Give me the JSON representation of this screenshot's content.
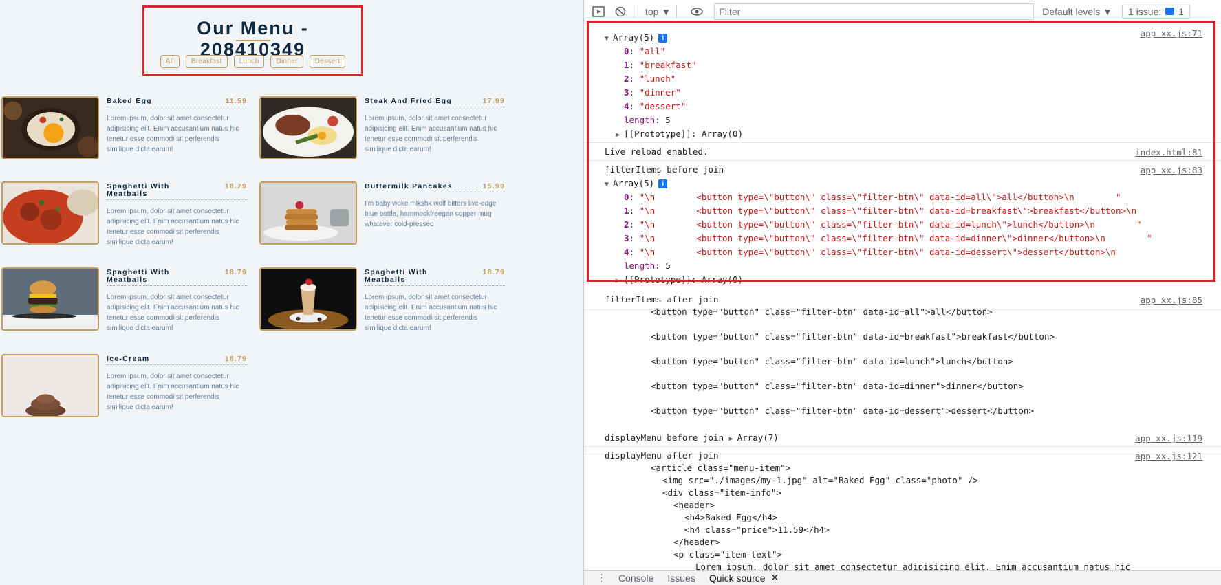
{
  "menu_page": {
    "title": "Our Menu - 208410349",
    "filters": [
      "All",
      "Breakfast",
      "Lunch",
      "Dinner",
      "Dessert"
    ],
    "items": [
      {
        "name": "Baked Egg",
        "price": "11.59",
        "text": "Lorem ipsum, dolor sit amet consectetur adipisicing elit. Enim accusantium natus hic tenetur esse commodi sit perferendis similique dicta earum!"
      },
      {
        "name": "Steak And Fried Egg",
        "price": "17.99",
        "text": "Lorem ipsum, dolor sit amet consectetur adipisicing elit. Enim accusantium natus hic tenetur esse commodi sit perferendis similique dicta earum!"
      },
      {
        "name": "Spaghetti With Meatballs",
        "price": "18.79",
        "text": "Lorem ipsum, dolor sit amet consectetur adipisicing elit. Enim accusantium natus hic tenetur esse commodi sit perferendis similique dicta earum!"
      },
      {
        "name": "Buttermilk Pancakes",
        "price": "15.99",
        "text": "I'm baby woke mlkshk wolf bitters live-edge blue bottle, hammockfreegan copper mug whatever cold-pressed"
      },
      {
        "name": "Spaghetti With Meatballs",
        "price": "18.79",
        "text": "Lorem ipsum, dolor sit amet consectetur adipisicing elit. Enim accusantium natus hic tenetur esse commodi sit perferendis similique dicta earum!"
      },
      {
        "name": "Spaghetti With Meatballs",
        "price": "18.79",
        "text": "Lorem ipsum, dolor sit amet consectetur adipisicing elit. Enim accusantium natus hic tenetur esse commodi sit perferendis similique dicta earum!"
      },
      {
        "name": "Ice-Cream",
        "price": "18.79",
        "text": "Lorem ipsum, dolor sit amet consectetur adipisicing elit. Enim accusantium natus hic tenetur esse commodi sit perferendis similique dicta earum!"
      }
    ]
  },
  "devtools": {
    "toolbar": {
      "context": "top ▼",
      "filter_placeholder": "Filter",
      "levels": "Default levels ▼",
      "issues": "1 issue:",
      "issues_count": "1"
    },
    "messages": {
      "m1": {
        "source": "app_xx.js:71",
        "array_label": "Array(5)",
        "entries": [
          {
            "k": "0",
            "v": "\"all\""
          },
          {
            "k": "1",
            "v": "\"breakfast\""
          },
          {
            "k": "2",
            "v": "\"lunch\""
          },
          {
            "k": "3",
            "v": "\"dinner\""
          },
          {
            "k": "4",
            "v": "\"dessert\""
          }
        ],
        "length_key": "length",
        "length_val": "5",
        "proto": "[[Prototype]]: Array(0)"
      },
      "m2": {
        "text": "Live reload enabled.",
        "source": "index.html:81"
      },
      "m3": {
        "text": "filterItems before join",
        "source": "app_xx.js:83",
        "array_label": "Array(5)",
        "entries": [
          {
            "k": "0",
            "v": "\"\\n        <button type=\\\"button\\\" class=\\\"filter-btn\\\" data-id=all\\\">all</button>\\n        \""
          },
          {
            "k": "1",
            "v": "\"\\n        <button type=\\\"button\\\" class=\\\"filter-btn\\\" data-id=breakfast\\\">breakfast</button>\\n"
          },
          {
            "k": "2",
            "v": "\"\\n        <button type=\\\"button\\\" class=\\\"filter-btn\\\" data-id=lunch\\\">lunch</button>\\n        \""
          },
          {
            "k": "3",
            "v": "\"\\n        <button type=\\\"button\\\" class=\\\"filter-btn\\\" data-id=dinner\\\">dinner</button>\\n        \""
          },
          {
            "k": "4",
            "v": "\"\\n        <button type=\\\"button\\\" class=\\\"filter-btn\\\" data-id=dessert\\\">dessert</button>\\n"
          }
        ],
        "length_key": "length",
        "length_val": "5",
        "proto": "[[Prototype]]: Array(0)"
      },
      "m4": {
        "text": "filterItems after join",
        "source": "app_xx.js:85",
        "lines": [
          "<button type=\"button\" class=\"filter-btn\" data-id=all\">all</button>",
          "<button type=\"button\" class=\"filter-btn\" data-id=breakfast\">breakfast</button>",
          "<button type=\"button\" class=\"filter-btn\" data-id=lunch\">lunch</button>",
          "<button type=\"button\" class=\"filter-btn\" data-id=dinner\">dinner</button>",
          "<button type=\"button\" class=\"filter-btn\" data-id=dessert\">dessert</button>"
        ]
      },
      "m5": {
        "text": "displayMenu before join",
        "array_label": "Array(7)",
        "source": "app_xx.js:119"
      },
      "m6": {
        "text": "displayMenu after join",
        "source": "app_xx.js:121",
        "lines": [
          "<article class=\"menu-item\">",
          "<img src=\"./images/my-1.jpg\" alt=\"Baked Egg\" class=\"photo\" />",
          "<div class=\"item-info\">",
          "<header>",
          "<h4>Baked Egg</h4>",
          "<h4 class=\"price\">11.59</h4>",
          "</header>",
          "<p class=\"item-text\">",
          "Lorem ipsum, dolor sit amet consectetur adipisicing elit. Enim accusantium natus hic"
        ]
      }
    },
    "drawer": {
      "tabs": [
        "Console",
        "Issues",
        "Quick source"
      ]
    }
  },
  "colors": {
    "accent_gold": "#c59d5f",
    "heading": "#102a42",
    "highlight_red": "#e3202a",
    "string_red": "#c41a16",
    "key_purple": "#881280"
  }
}
